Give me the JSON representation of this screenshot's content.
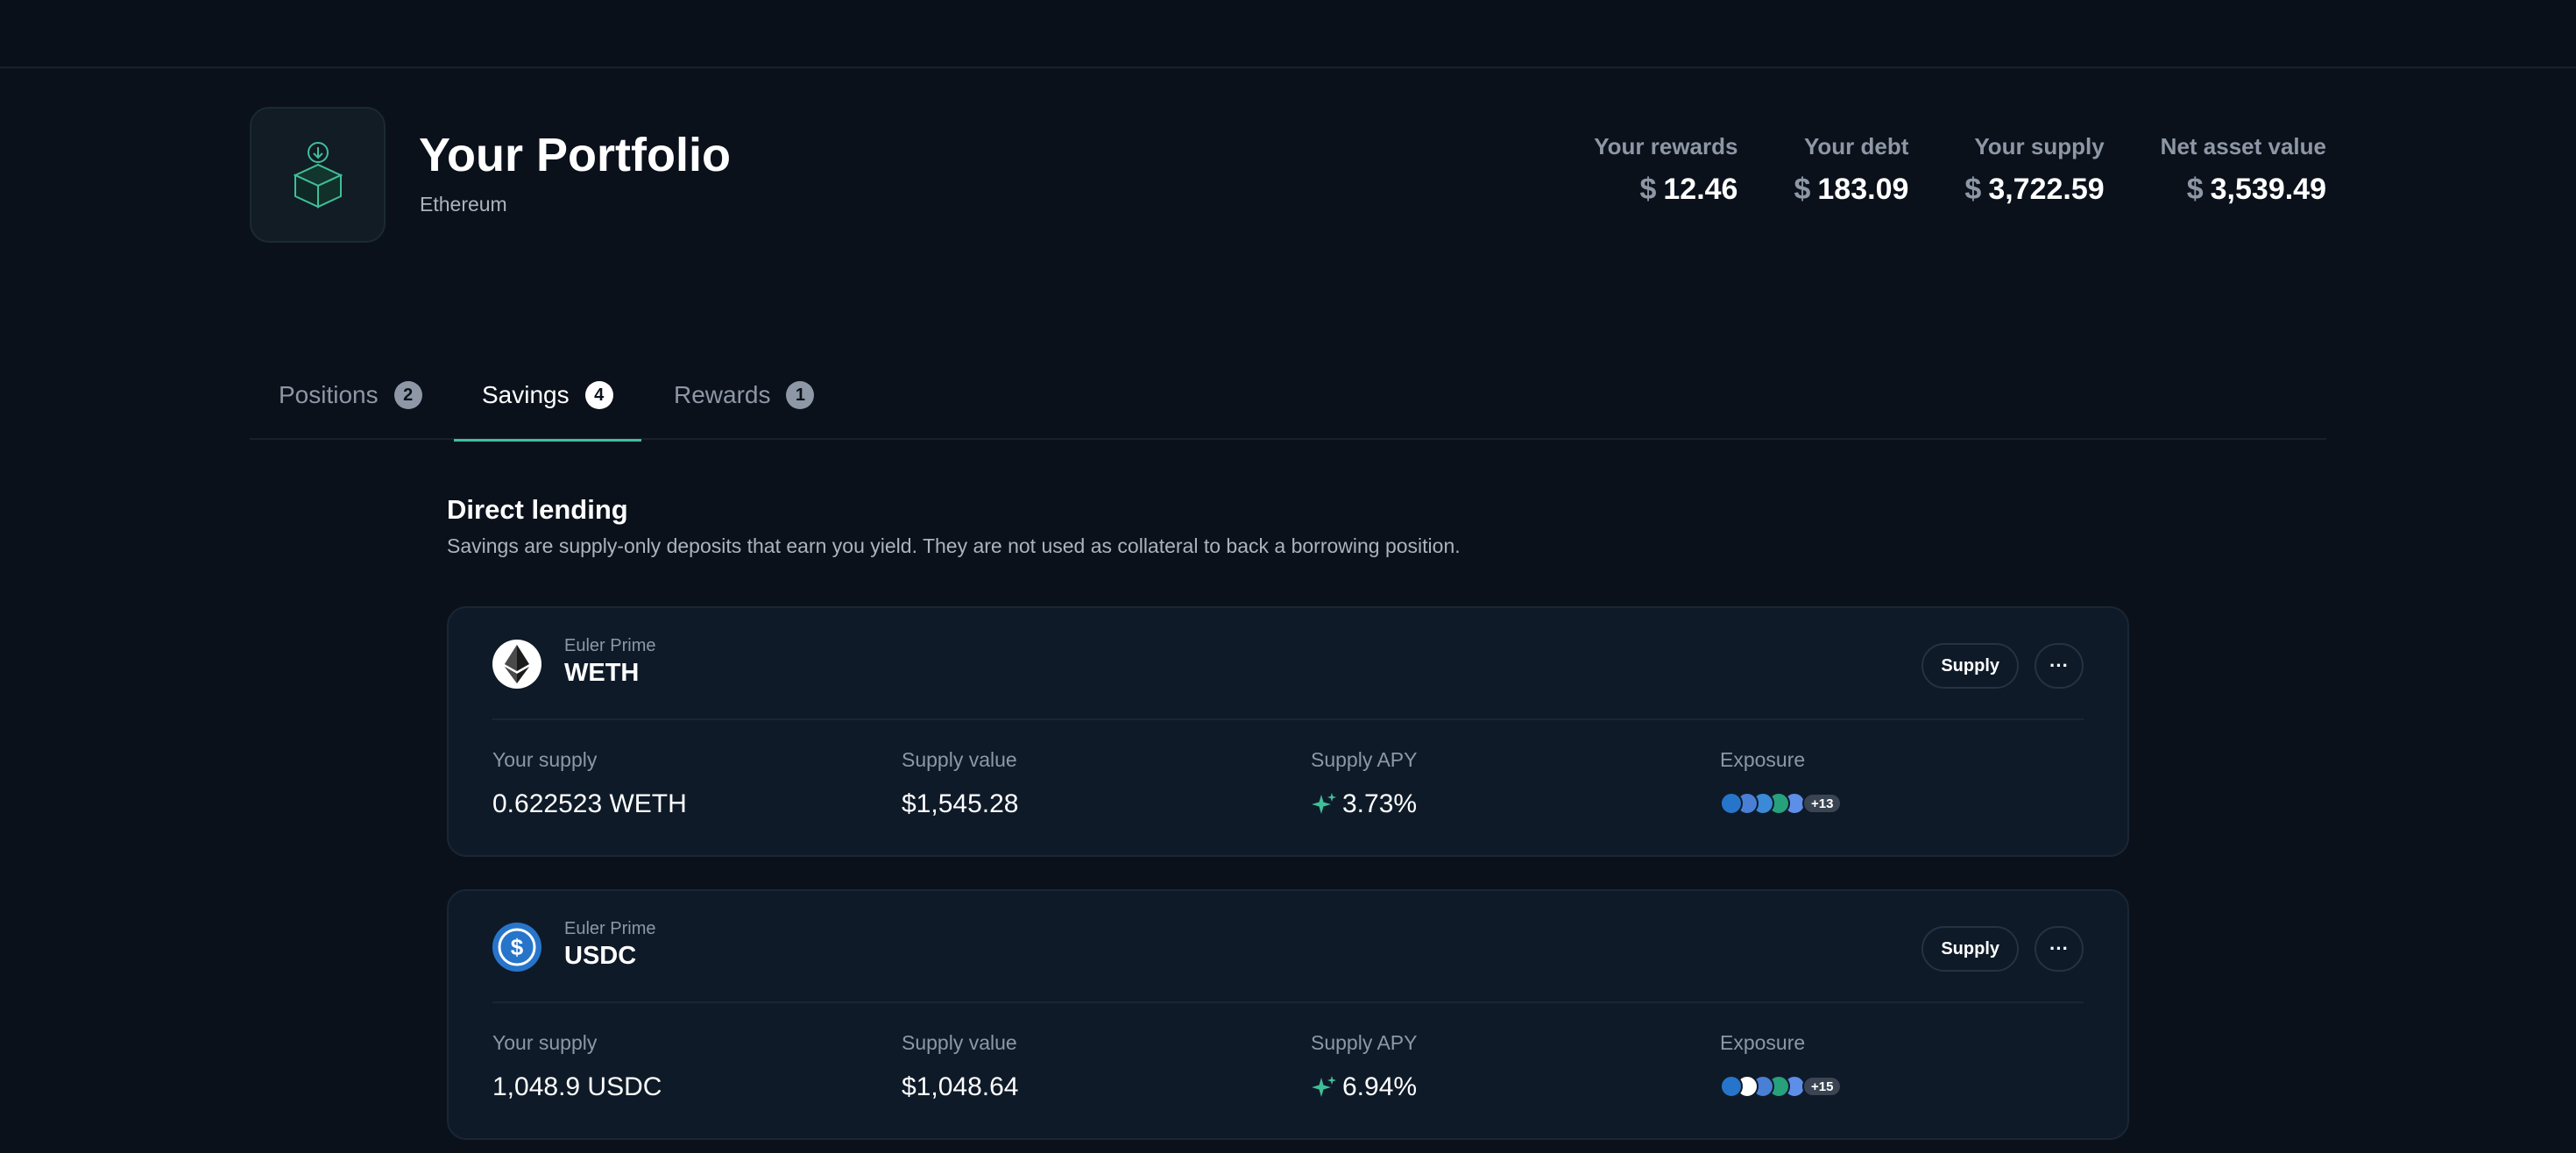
{
  "header": {
    "title": "Your Portfolio",
    "network": "Ethereum",
    "stats": [
      {
        "label": "Your rewards",
        "currency": "$",
        "value": "12.46"
      },
      {
        "label": "Your debt",
        "currency": "$",
        "value": "183.09"
      },
      {
        "label": "Your supply",
        "currency": "$",
        "value": "3,722.59"
      },
      {
        "label": "Net asset value",
        "currency": "$",
        "value": "3,539.49"
      }
    ]
  },
  "tabs": [
    {
      "label": "Positions",
      "count": "2"
    },
    {
      "label": "Savings",
      "count": "4"
    },
    {
      "label": "Rewards",
      "count": "1"
    }
  ],
  "section": {
    "title": "Direct lending",
    "description": "Savings are supply-only deposits that earn you yield. They are not used as collateral to back a borrowing position."
  },
  "labels": {
    "your_supply": "Your supply",
    "supply_value": "Supply value",
    "supply_apy": "Supply APY",
    "exposure": "Exposure",
    "supply_button": "Supply",
    "more_button": "···"
  },
  "cards": [
    {
      "vault": "Euler Prime",
      "asset": "WETH",
      "icon": "ethereum-icon",
      "your_supply": "0.622523 WETH",
      "supply_value": "$1,545.28",
      "supply_apy": "3.73%",
      "exposure_more": "+13"
    },
    {
      "vault": "Euler Prime",
      "asset": "USDC",
      "icon": "usdc-icon",
      "your_supply": "1,048.9 USDC",
      "supply_value": "$1,048.64",
      "supply_apy": "6.94%",
      "exposure_more": "+15"
    }
  ],
  "colors": {
    "background": "#0b111b",
    "card": "#0f1a28",
    "accent": "#3fbf98",
    "muted": "#8d97a5",
    "usdc": "#2775ca"
  }
}
